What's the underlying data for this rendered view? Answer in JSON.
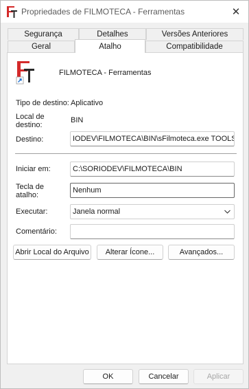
{
  "window": {
    "title": "Propriedades de FILMOTECA - Ferramentas",
    "close_glyph": "✕"
  },
  "tabs": {
    "row1": [
      "Segurança",
      "Detalhes",
      "Versões Anteriores"
    ],
    "row2": [
      "Geral",
      "Atalho",
      "Compatibilidade"
    ],
    "active": "Atalho"
  },
  "shortcut": {
    "name": "FILMOTECA - Ferramentas",
    "target_type_label": "Tipo de destino:",
    "target_type_value": "Aplicativo",
    "target_location_label": "Local de destino:",
    "target_location_value": "BIN",
    "target_label": "Destino:",
    "target_value": "IODEV\\FILMOTECA\\BIN\\sFilmoteca.exe TOOLS",
    "start_in_label": "Iniciar em:",
    "start_in_value": "C:\\SORIODEV\\FILMOTECA\\BIN",
    "hotkey_label": "Tecla de atalho:",
    "hotkey_value": "Nenhum",
    "run_label": "Executar:",
    "run_value": "Janela normal",
    "comment_label": "Comentário:",
    "comment_value": ""
  },
  "buttons": {
    "open_location": "Abrir Local do Arquivo",
    "change_icon": "Alterar Ícone...",
    "advanced": "Avançados...",
    "ok": "OK",
    "cancel": "Cancelar",
    "apply": "Aplicar"
  },
  "colors": {
    "icon_red": "#d42a2a",
    "icon_dark": "#2a2a2a",
    "shortcut_arrow": "#1a6fd1"
  }
}
